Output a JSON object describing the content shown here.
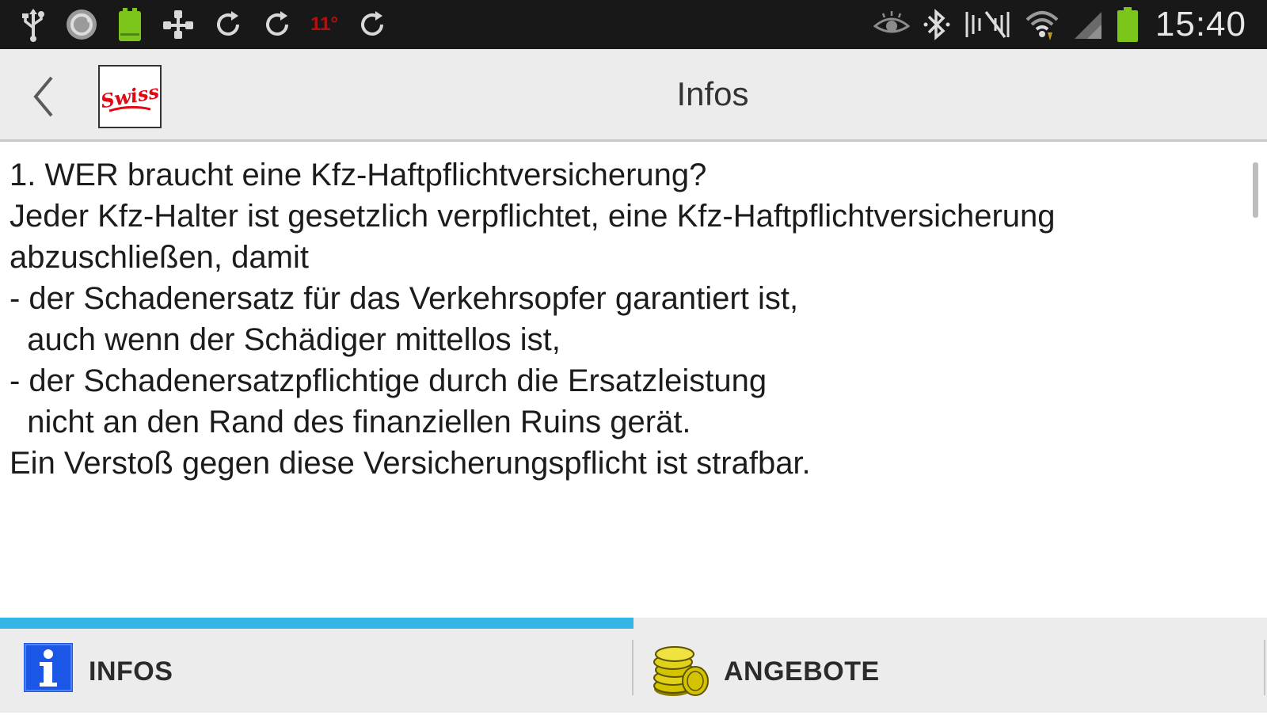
{
  "status_bar": {
    "time": "15:40",
    "left_icons": [
      "usb-icon",
      "sync-circle-icon",
      "android-icon",
      "network-transfer-icon",
      "refresh-icon",
      "refresh-icon",
      "temperature-icon",
      "refresh-icon"
    ],
    "temperature_text": "11°",
    "right_icons": [
      "eye-icon",
      "bluetooth-icon",
      "nfc-mute-icon",
      "wifi-icon",
      "cell-signal-icon",
      "battery-icon"
    ],
    "battery_color": "#7cc61c"
  },
  "action_bar": {
    "title": "Infos",
    "logo_text": "Swiss"
  },
  "content": {
    "lines": [
      "1. WER braucht eine Kfz-Haftpflichtversicherung?",
      "",
      "Jeder Kfz-Halter ist gesetzlich verpflichtet, eine Kfz-Haftpflichtversicherung",
      "abzuschließen, damit",
      "",
      "- der Schadenersatz für das Verkehrsopfer garantiert ist,",
      "  auch wenn der Schädiger mittellos ist,",
      "- der Schadenersatzpflichtige durch die Ersatzleistung",
      "  nicht an den Rand des finanziellen Ruins gerät.",
      "",
      "Ein Verstoß gegen diese Versicherungspflicht ist strafbar."
    ]
  },
  "tabs": [
    {
      "label": "INFOS",
      "icon": "info-icon",
      "selected": true
    },
    {
      "label": "ANGEBOTE",
      "icon": "coins-icon",
      "selected": false
    }
  ],
  "colors": {
    "accent": "#33b5e5",
    "status_bar_bg": "#181818",
    "action_bar_bg": "#ececec",
    "info_icon_blue": "#1a57e6",
    "logo_red": "#e30613",
    "coins_gold": "#c9b200"
  }
}
